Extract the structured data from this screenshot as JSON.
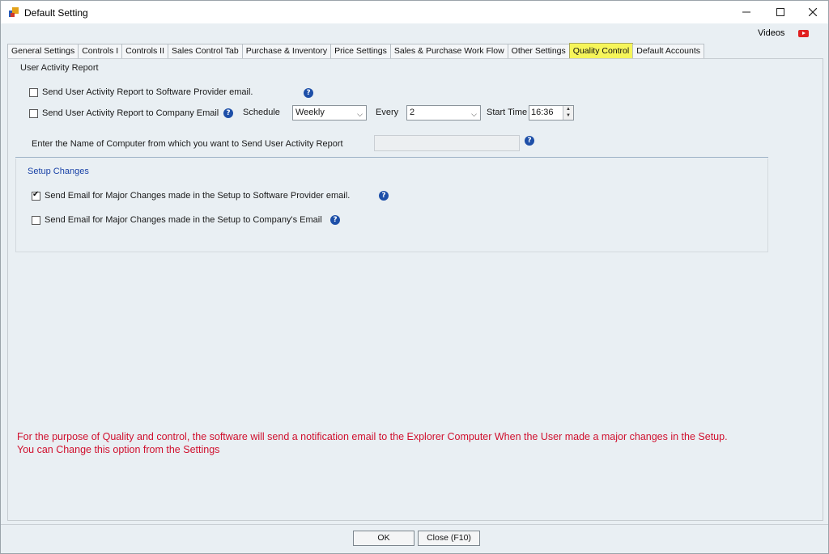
{
  "window": {
    "title": "Default Setting",
    "controls": {
      "minimize": "—",
      "maximize": "☐",
      "close": "✕"
    }
  },
  "videos": {
    "label": "Videos",
    "icon": "youtube-icon"
  },
  "tabs": [
    {
      "label": "General Settings",
      "active": false
    },
    {
      "label": "Controls I",
      "active": false
    },
    {
      "label": "Controls II",
      "active": false
    },
    {
      "label": "Sales Control Tab",
      "active": false
    },
    {
      "label": "Purchase & Inventory",
      "active": false
    },
    {
      "label": "Price Settings",
      "active": false
    },
    {
      "label": "Sales & Purchase Work Flow",
      "active": false
    },
    {
      "label": "Other Settings",
      "active": false
    },
    {
      "label": "Quality Control",
      "active": true
    },
    {
      "label": "Default Accounts",
      "active": false
    }
  ],
  "user_activity": {
    "title": "User Activity Report",
    "send_to_provider": {
      "label": "Send User Activity Report to Software Provider email.",
      "checked": false
    },
    "send_to_company": {
      "label": "Send User Activity Report to Company Email",
      "checked": false
    },
    "schedule_label": "Schedule",
    "schedule_value": "Weekly",
    "every_label": "Every",
    "every_value": "2",
    "start_time_label": "Start Time",
    "start_time_value": "16:36",
    "computer_name_label": "Enter the Name of Computer from which you want to  Send User Activity Report",
    "computer_name_value": ""
  },
  "setup_changes": {
    "title": "Setup Changes",
    "email_provider": {
      "label": "Send Email for Major Changes made in the Setup to Software Provider email.",
      "checked": true
    },
    "email_company": {
      "label": "Send Email for Major Changes made in the Setup to Company's Email",
      "checked": false
    }
  },
  "note": "For the purpose of Quality and control, the software will send a notification email to the Explorer Computer When the User made a major changes in the Setup. You can Change this option from the Settings",
  "buttons": {
    "ok": "OK",
    "close": "Close (F10)"
  },
  "colors": {
    "active_tab": "#f6f55a",
    "note_text": "#d0102e",
    "help_icon": "#1d4fa8",
    "setup_title": "#1c44a8"
  }
}
